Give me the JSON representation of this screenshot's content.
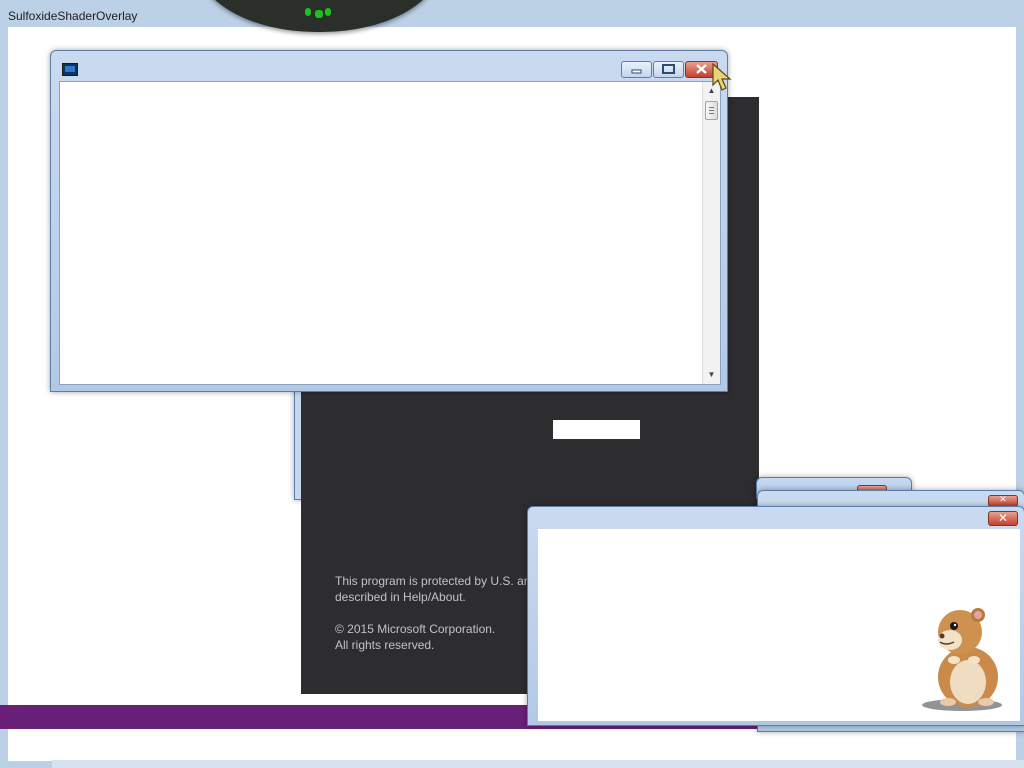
{
  "main_window": {
    "title": "SulfoxideShaderOverlay"
  },
  "splash": {
    "copyright_notice": "This program is protected by U.S. and international copyright laws as described in Help/About.",
    "copyright_line1": "© 2015 Microsoft Corporation.",
    "copyright_line2": "All rights reserved."
  },
  "dialog": {
    "title": "",
    "buttons": {
      "minimize": "minimize",
      "maximize": "maximize",
      "close": "close"
    }
  },
  "popups": {
    "close_glyph": "✕"
  },
  "icons": [
    "window-system-icon",
    "minimize-icon",
    "maximize-icon",
    "close-icon",
    "scroll-up-icon",
    "scroll-down-icon",
    "hamster-mascot-icon",
    "mouse-cursor-icon"
  ],
  "colors": {
    "accent_purple": "#6a1f78",
    "splash_bg": "#2d2d30",
    "close_red": "#c2412b",
    "frame_blue": "#b2c9e6"
  }
}
